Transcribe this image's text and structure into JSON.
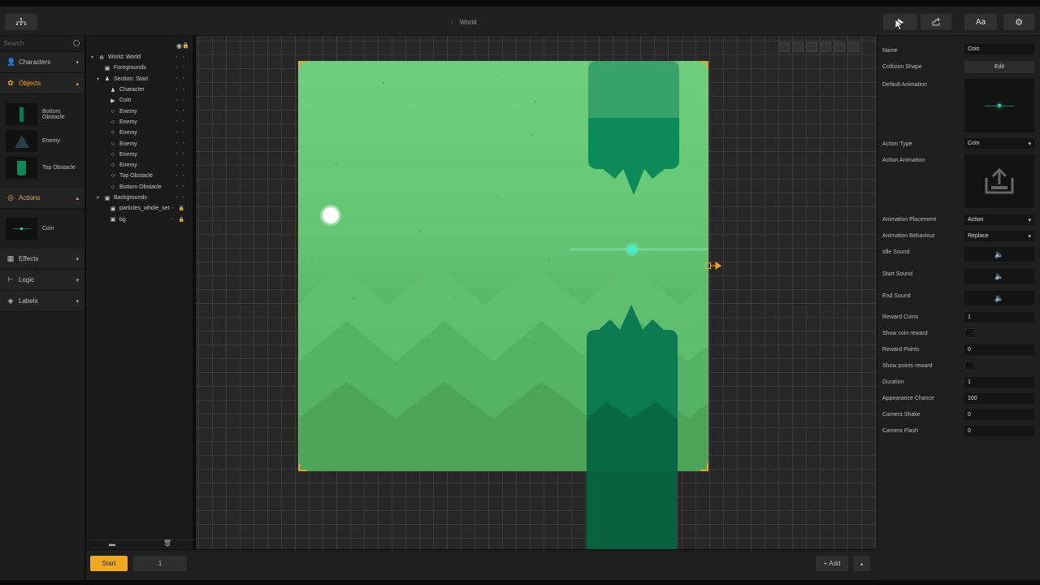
{
  "topbar": {
    "title": "World",
    "text_button": "Aa"
  },
  "library": {
    "search_placeholder": "Search",
    "sections": {
      "characters": "Characters",
      "objects": "Objects",
      "actions": "Actions",
      "effects": "Effects",
      "logic": "Logic",
      "labels": "Labels"
    },
    "objects": [
      "Bottom Obstacle",
      "Enemy",
      "Top Obstacle"
    ],
    "actions": [
      "Coin"
    ]
  },
  "hierarchy": {
    "rows": [
      {
        "label": "World: World",
        "icon": "globe-icon",
        "indent": 0,
        "twisty": "▾"
      },
      {
        "label": "Foregrounds",
        "icon": "image-icon",
        "indent": 1,
        "twisty": ""
      },
      {
        "label": "Section: Start",
        "icon": "person-icon",
        "indent": 1,
        "twisty": "▾"
      },
      {
        "label": "Character",
        "icon": "person-icon",
        "indent": 2,
        "twisty": ""
      },
      {
        "label": "Coin",
        "icon": "play-icon",
        "indent": 2,
        "twisty": ""
      },
      {
        "label": "Enemy",
        "icon": "circle-icon",
        "indent": 2,
        "twisty": ""
      },
      {
        "label": "Enemy",
        "icon": "circle-icon",
        "indent": 2,
        "twisty": ""
      },
      {
        "label": "Enemy",
        "icon": "circle-icon",
        "indent": 2,
        "twisty": ""
      },
      {
        "label": "Enemy",
        "icon": "circle-icon",
        "indent": 2,
        "twisty": ""
      },
      {
        "label": "Enemy",
        "icon": "circle-icon",
        "indent": 2,
        "twisty": ""
      },
      {
        "label": "Enemy",
        "icon": "circle-icon",
        "indent": 2,
        "twisty": ""
      },
      {
        "label": "Top Obstacle",
        "icon": "circle-icon",
        "indent": 2,
        "twisty": ""
      },
      {
        "label": "Bottom Obstacle",
        "icon": "circle-icon",
        "indent": 2,
        "twisty": ""
      },
      {
        "label": "Backgrounds",
        "icon": "image-icon",
        "indent": 1,
        "twisty": "▾"
      },
      {
        "label": "particles_whole_set",
        "icon": "image-icon",
        "indent": 2,
        "twisty": "",
        "locked": true
      },
      {
        "label": "bg",
        "icon": "image-icon",
        "indent": 2,
        "twisty": "",
        "locked": true
      }
    ]
  },
  "bottombar": {
    "start_tab": "Start",
    "section_count": "1",
    "add_label": "+ Add"
  },
  "properties": {
    "name_label": "Name",
    "name_value": "Coin",
    "collision_label": "Collision Shape",
    "collision_button": "Edit",
    "default_anim_label": "Default Animation",
    "action_type_label": "Action Type",
    "action_type_value": "Coin",
    "action_anim_label": "Action Animation",
    "anim_placement_label": "Animation Placement",
    "anim_placement_value": "Action",
    "anim_behaviour_label": "Animation Behaviour",
    "anim_behaviour_value": "Replace",
    "idle_sound_label": "Idle Sound",
    "start_sound_label": "Start Sound",
    "end_sound_label": "End Sound",
    "reward_coins_label": "Reward Coins",
    "reward_coins_value": "1",
    "show_coin_reward_label": "Show coin reward",
    "reward_points_label": "Reward Points",
    "reward_points_value": "0",
    "show_points_reward_label": "Show points reward",
    "duration_label": "Duration",
    "duration_value": "1",
    "appearance_label": "Appearance Chance",
    "appearance_value": "100",
    "camera_shake_label": "Camera Shake",
    "camera_shake_value": "0",
    "camera_flash_label": "Camera Flash",
    "camera_flash_value": "0"
  },
  "colors": {
    "accent": "#f0a820",
    "scene_green": "#6ecf7e",
    "obstacle": "#0b7a52",
    "coin_glow": "#3cf5d0"
  }
}
